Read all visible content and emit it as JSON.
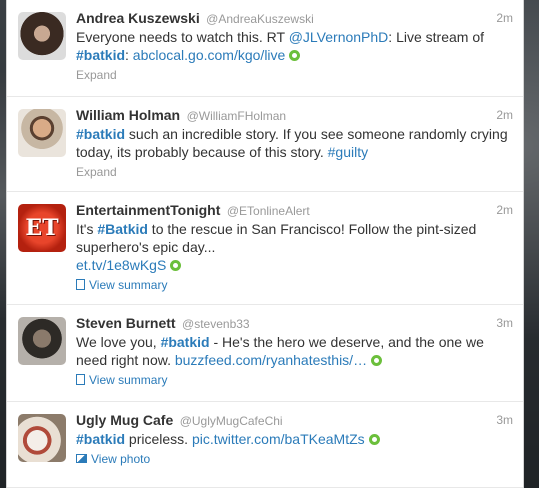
{
  "tweets": [
    {
      "fullname": "Andrea Kuszewski",
      "username": "@AndreaKuszewski",
      "time": "2m",
      "text": {
        "t1": "Everyone needs to watch this. RT ",
        "mention": "@JLVernonPhD",
        "t2": ": Live stream of ",
        "hashtag": "#batkid",
        "t3": ": ",
        "link": "abclocal.go.com/kgo/live"
      },
      "action": "Expand"
    },
    {
      "fullname": "William Holman",
      "username": "@WilliamFHolman",
      "time": "2m",
      "text": {
        "hashtag": "#batkid",
        "t1": " such an incredible story. If you see someone randomly crying today, its probably because of this story. ",
        "hashtag2": "#guilty"
      },
      "action": "Expand"
    },
    {
      "fullname": "EntertainmentTonight",
      "username": "@ETonlineAlert",
      "time": "2m",
      "avatar_text": "ET",
      "text": {
        "t1": "It's ",
        "hashtag": "#Batkid",
        "t2": " to the rescue in San Francisco! Follow the pint-sized superhero's epic day...",
        "link": "et.tv/1e8wKgS"
      },
      "action": "View summary"
    },
    {
      "fullname": "Steven Burnett",
      "username": "@stevenb33",
      "time": "3m",
      "text": {
        "t1": "We love you, ",
        "hashtag": "#batkid",
        "t2": " - He's the hero we deserve, and the one we need right now.  ",
        "link": "buzzfeed.com/ryanhatesthis/…"
      },
      "action": "View summary"
    },
    {
      "fullname": "Ugly Mug Cafe",
      "username": "@UglyMugCafeChi",
      "time": "3m",
      "text": {
        "hashtag": "#batkid",
        "t1": " priceless. ",
        "link": "pic.twitter.com/baTKeaMtZs"
      },
      "action": "View photo"
    }
  ],
  "colors": {
    "link": "#2b7bb9",
    "live_indicator": "#6bbf3b",
    "muted": "#999999"
  }
}
